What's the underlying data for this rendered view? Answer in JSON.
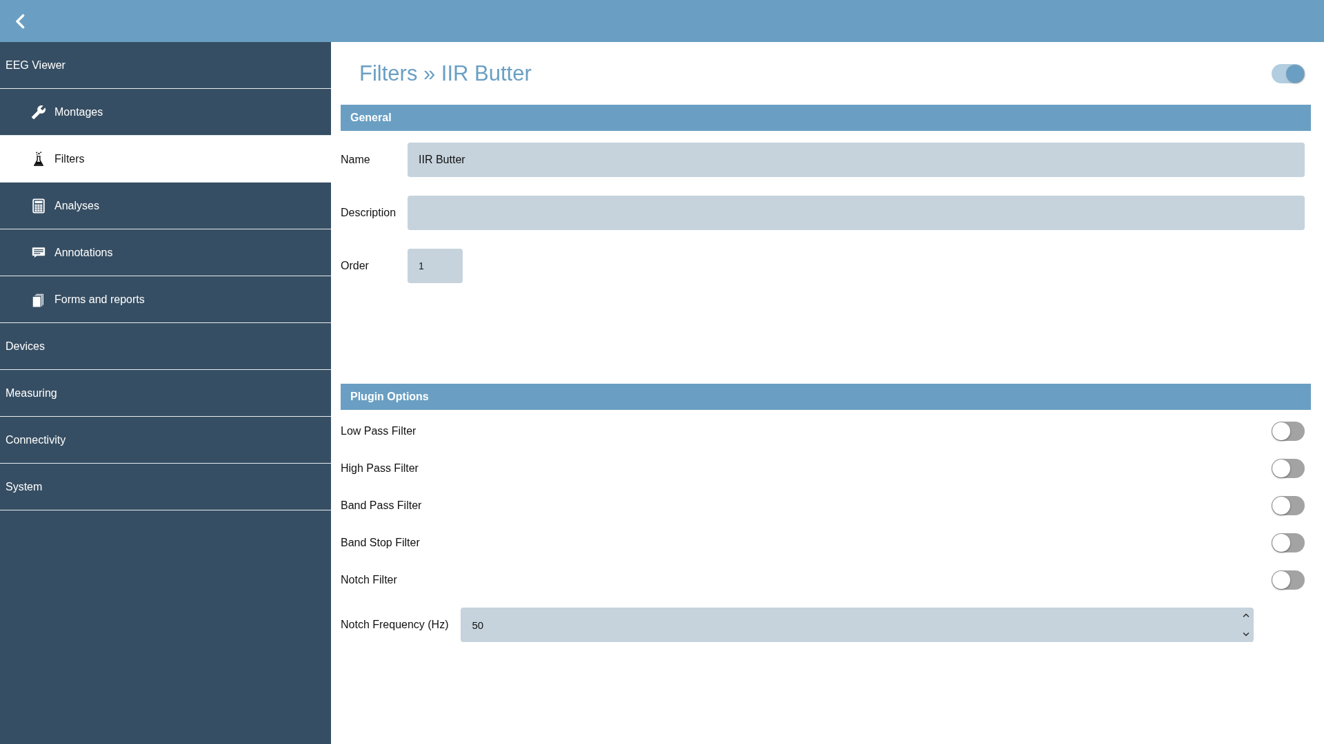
{
  "sidebar": {
    "items": [
      {
        "label": "EEG Viewer",
        "selected": false,
        "children": [
          {
            "label": "Montages",
            "selected": false
          },
          {
            "label": "Filters",
            "selected": true
          },
          {
            "label": "Analyses",
            "selected": false
          },
          {
            "label": "Annotations",
            "selected": false
          },
          {
            "label": "Forms and reports",
            "selected": false
          }
        ]
      },
      {
        "label": "Devices",
        "selected": false
      },
      {
        "label": "Measuring",
        "selected": false
      },
      {
        "label": "Connectivity",
        "selected": false
      },
      {
        "label": "System",
        "selected": false
      }
    ]
  },
  "page": {
    "title": "Filters » IIR Butter",
    "enabled": true
  },
  "sections": [
    {
      "title": "General",
      "fields": [
        {
          "kind": "text",
          "label": "Name",
          "value": "IIR Butter"
        },
        {
          "kind": "text",
          "label": "Description"
        },
        {
          "kind": "number",
          "label": "Order",
          "value": "1"
        }
      ]
    },
    {
      "title": "Plugin Options",
      "fields": [
        {
          "kind": "switch",
          "label": "Low Pass Filter",
          "on": false
        },
        {
          "kind": "switch",
          "label": "High Pass Filter",
          "on": false
        },
        {
          "kind": "switch",
          "label": "Band Pass Filter",
          "on": false
        },
        {
          "kind": "switch",
          "label": "Band Stop Filter",
          "on": false
        },
        {
          "kind": "switch",
          "label": "Notch Filter",
          "on": false
        },
        {
          "kind": "spinner",
          "label": "Notch Frequency (Hz)",
          "value": "50"
        }
      ]
    }
  ]
}
